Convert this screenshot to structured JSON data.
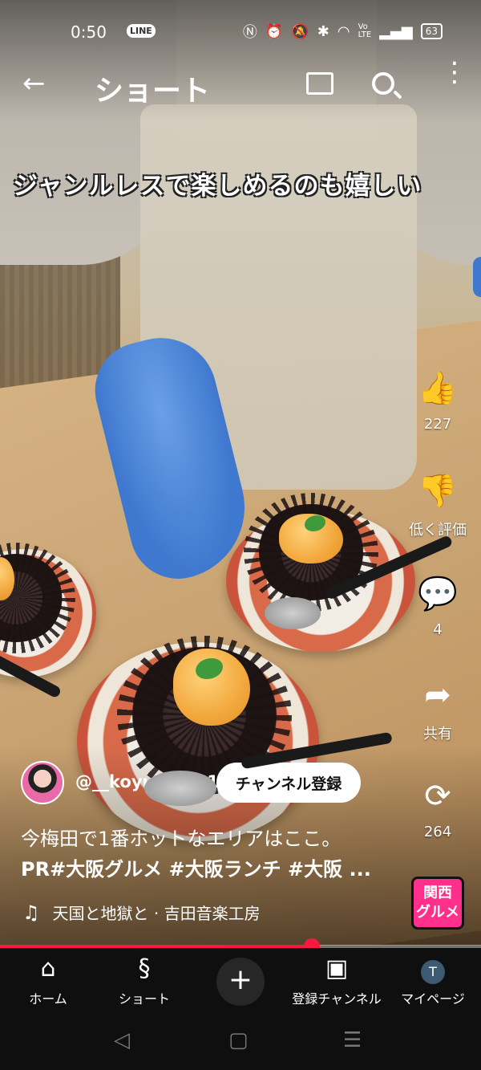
{
  "status_bar": {
    "time": "0:50",
    "line_icon": "LINE",
    "icons": [
      "N",
      "⏰",
      "🔕",
      "✱",
      "wifi",
      "VoLTE",
      "signal"
    ],
    "battery": "63"
  },
  "topbar": {
    "back_icon": "←",
    "title": "ショート",
    "menu_icon": "⋮"
  },
  "video": {
    "caption": "ジャンルレスで楽しめるのも嬉しい"
  },
  "actions": {
    "like_count": "227",
    "dislike_label": "低く評価",
    "comment_count": "4",
    "share_label": "共有",
    "remix_count": "264",
    "like_icon": "👍",
    "dislike_icon": "👎",
    "comment_icon": "💬",
    "share_icon": "➦",
    "remix_icon": "⟳"
  },
  "channel": {
    "handle": "@__koyuking01",
    "subscribe_label": "チャンネル登録"
  },
  "description": {
    "line1": "今梅田で1番ホットなエリアはここ。",
    "line2": "PR#大阪グルメ #大阪ランチ #大阪 ..."
  },
  "music": {
    "note_icon": "♫",
    "text": "天国と地獄と · 吉田音楽工房"
  },
  "badge": {
    "line1": "関西",
    "line2": "グルメ"
  },
  "progress": {
    "fraction": 0.648
  },
  "bottom_nav": {
    "home_label": "ホーム",
    "shorts_label": "ショート",
    "create_icon": "+",
    "subscriptions_label": "登録チャンネル",
    "you_label": "マイページ",
    "you_avatar_letter": "T"
  },
  "system_nav": {
    "back": "◁",
    "home": "▢",
    "recents": "☰"
  },
  "colors": {
    "accent": "#ff1744",
    "nav_bg": "#0f0f0f",
    "badge_bg": "#ff2f8c"
  }
}
